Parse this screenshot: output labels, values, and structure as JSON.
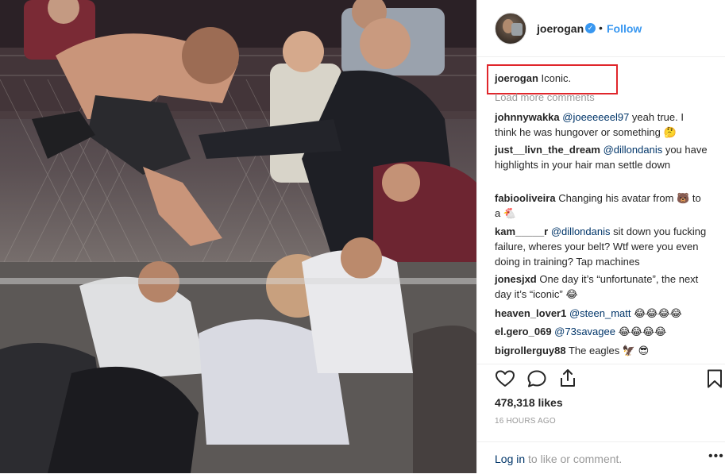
{
  "post": {
    "image_alt": "",
    "author": {
      "username": "joerogan",
      "verified_glyph": "✓",
      "separator": "•",
      "follow_label": "Follow"
    },
    "caption": {
      "username": "joerogan",
      "text": "Iconic."
    },
    "load_more_label": "Load more comments",
    "comments": [
      {
        "user": "johnnywakka",
        "mention": "@joeeeeeel97",
        "text": " yeah true. I think he was hungover or something 🤔"
      },
      {
        "user": "just__livn_the_dream",
        "mention": "@dillondanis",
        "text": " you have highlights in your hair man settle down"
      },
      {
        "user": "fabiooliveira",
        "mention": "",
        "text": " Changing his avatar from 🐻 to a 🐔"
      },
      {
        "user": "kam_____r",
        "mention": "@dillondanis",
        "text": " sit down you fucking failure, wheres your belt? Wtf were you even doing in training? Tap machines"
      },
      {
        "user": "jonesjxd",
        "mention": "",
        "text": " One day it’s “unfortunate”, the next day it’s “iconic” 😂"
      },
      {
        "user": "heaven_lover1",
        "mention": "@steen_matt",
        "text": " 😂😂😂😂"
      },
      {
        "user": "el.gero_069",
        "mention": "@73savagee",
        "text": " 😂😂😂😂"
      },
      {
        "user": "bigrollerguy88",
        "mention": "",
        "text": " The eagles 🦅 😎"
      }
    ],
    "likes_text": "478,318 likes",
    "timestamp": "16 HOURS AGO",
    "login_link": "Log in",
    "login_suffix": " to like or comment.",
    "more_glyph": "•••",
    "icons": {
      "like": "heart-icon",
      "comment": "comment-bubble-icon",
      "share": "share-icon",
      "save": "bookmark-icon"
    },
    "colors": {
      "accent": "#3897f0",
      "highlight_box": "#e0262b",
      "muted": "#999999",
      "link": "#003569"
    }
  }
}
